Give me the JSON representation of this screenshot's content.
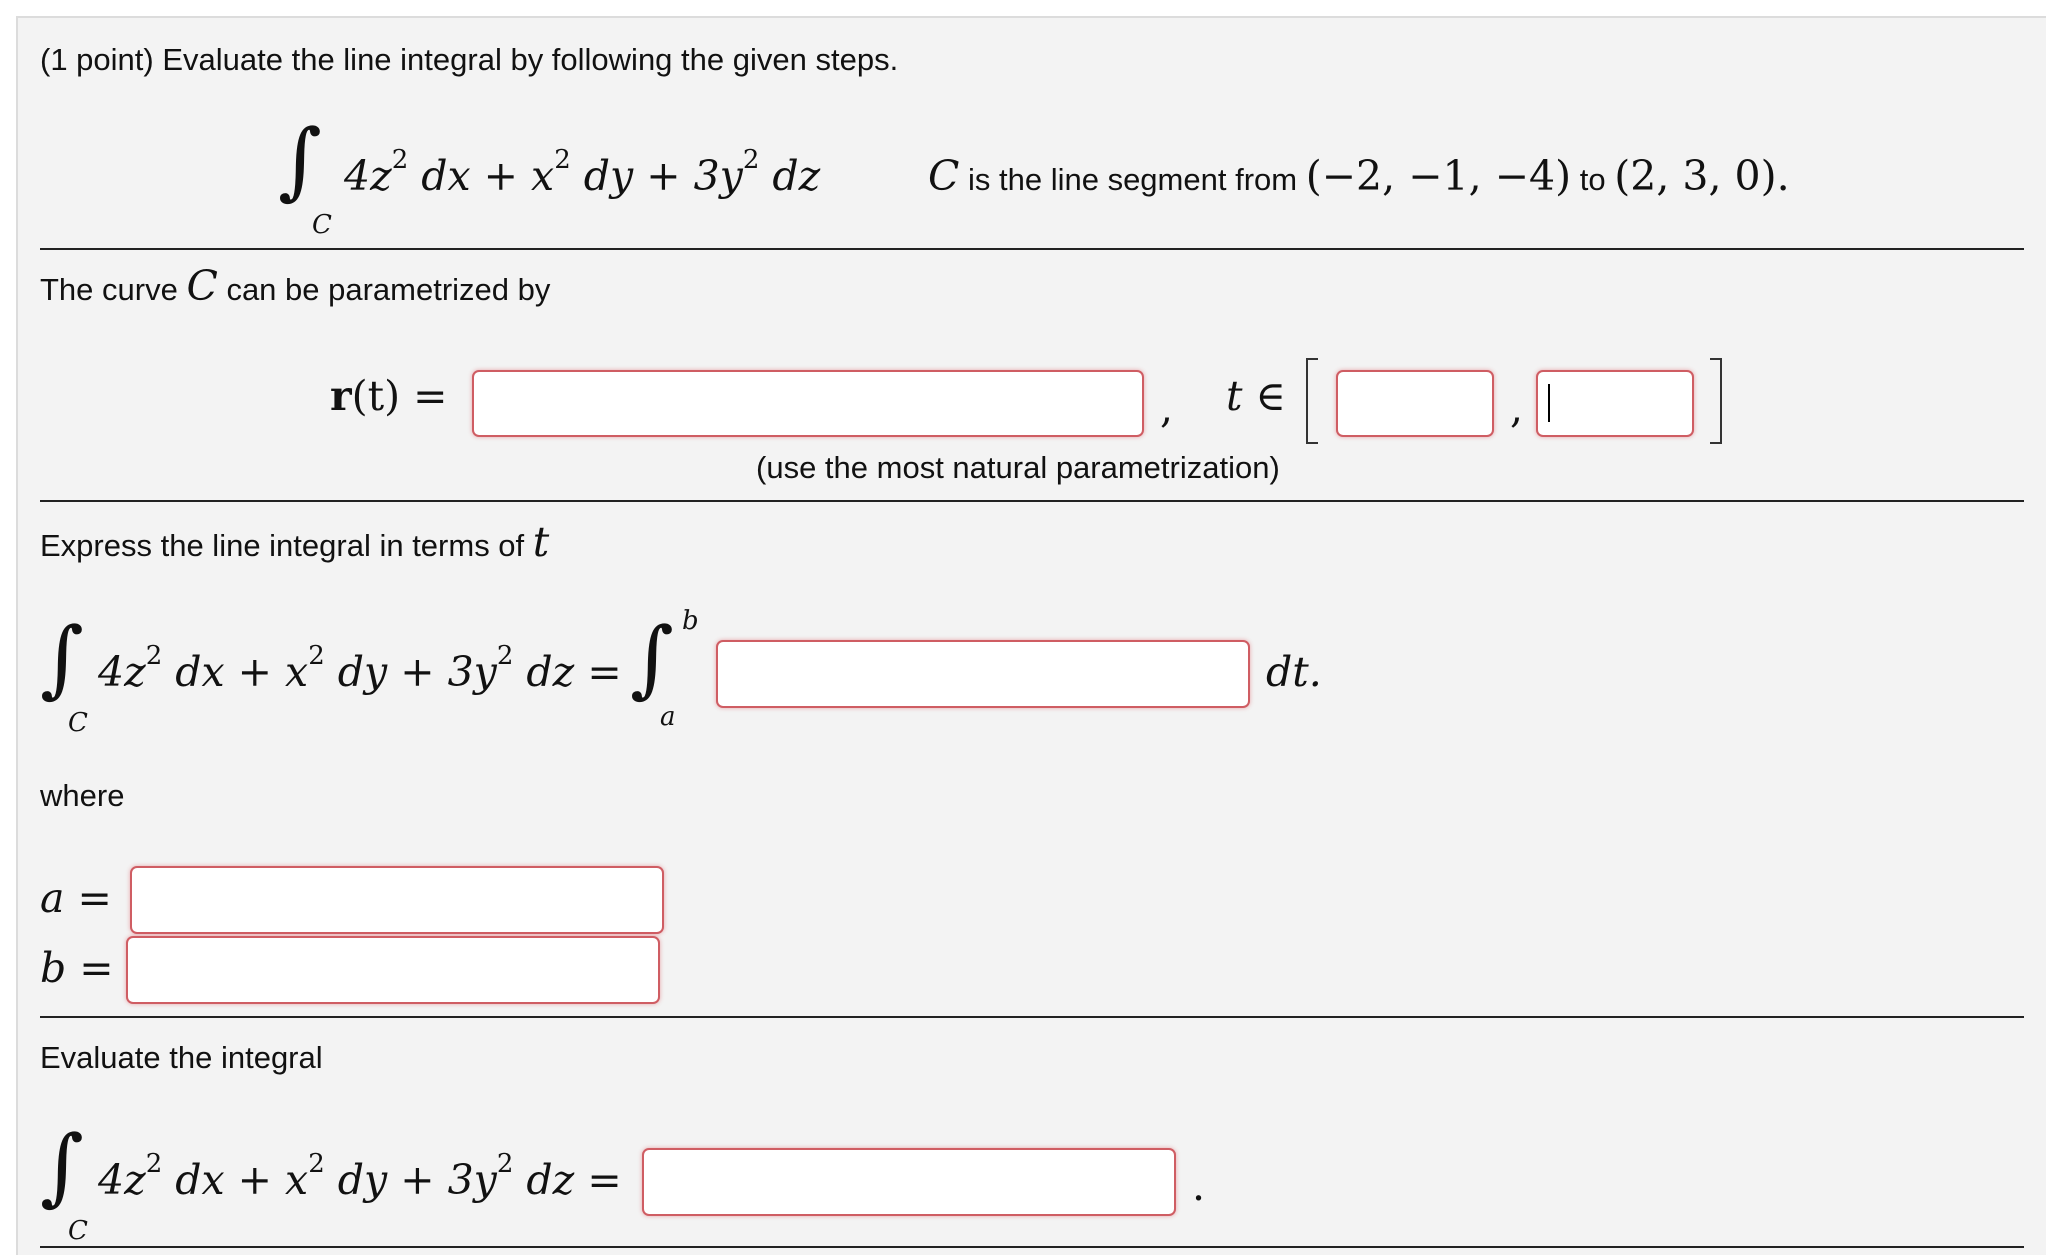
{
  "problem": {
    "header": "(1 point) Evaluate the line integral by following the given steps.",
    "integral_sub": "C",
    "integrand": {
      "t1": "4z",
      "e1": "2",
      "d1": " dx + x",
      "e2": "2",
      "d2": " dy + 3y",
      "e3": "2",
      "d3": " dz"
    },
    "curve_symbol": "C",
    "curve_text_1": " is the line segment from ",
    "point_from": "(−2, −1, −4)",
    "curve_text_2": " to ",
    "point_to": "(2, 3, 0)",
    "period": "."
  },
  "param_section": {
    "text_1": "The curve ",
    "symbol": "C",
    "text_2": " can be parametrized by",
    "r_bold": "r",
    "r_arg": "(t) =",
    "comma": ",",
    "t_in": "t ∈",
    "interval_comma": ",",
    "note": "(use the most natural parametrization)",
    "r_value": "",
    "t_start_value": "",
    "t_end_value": ""
  },
  "express_section": {
    "text": "Express the line integral in terms of ",
    "symbol": "t",
    "equals": " =",
    "upper_limit": "b",
    "lower_limit": "a",
    "dt": "dt.",
    "integrand_value": "",
    "where": "where",
    "a_label": "a =",
    "b_label": "b =",
    "a_value": "",
    "b_value": ""
  },
  "evaluate_section": {
    "text": "Evaluate the integral",
    "equals": " =",
    "period": ".",
    "result_value": ""
  },
  "colors": {
    "background": "#f3f3f3",
    "input_border": "#cf5d63",
    "rule": "#222222"
  }
}
